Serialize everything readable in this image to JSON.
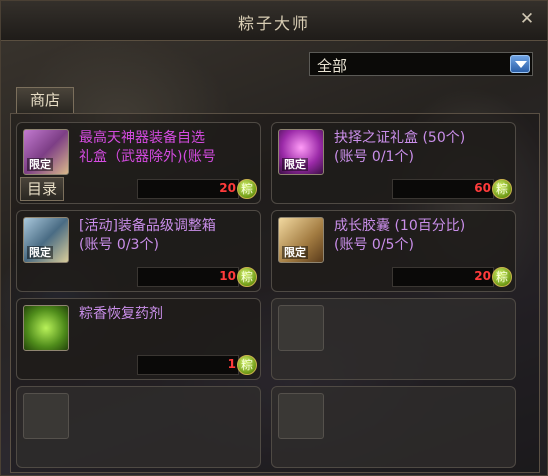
{
  "window": {
    "title": "粽子大师",
    "close_label": "✕"
  },
  "filter": {
    "selected": "全部"
  },
  "tab": {
    "label": "商店"
  },
  "menu_tag": {
    "label": "目录"
  },
  "items": [
    {
      "name": "最高天神器装备自选\n礼盒（武器除外)(账号",
      "badge": "限定",
      "price": "20",
      "color": "purple",
      "icon": "purple-chest-icon"
    },
    {
      "name": "抉择之证礼盒 (50个)\n(账号 0/1个)",
      "badge": "限定",
      "price": "60",
      "color": "lavender",
      "icon": "magic-chest-icon"
    },
    {
      "name": "[活动]装备品级调整箱\n(账号 0/3个)",
      "badge": "限定",
      "price": "10",
      "color": "lavender",
      "icon": "blue-chest-icon"
    },
    {
      "name": "成长胶囊 (10百分比)\n(账号 0/5个)",
      "badge": "限定",
      "price": "20",
      "color": "lavender",
      "icon": "scroll-icon"
    },
    {
      "name": "粽香恢复药剂",
      "badge": "",
      "price": "1",
      "color": "lavender",
      "icon": "potion-icon"
    }
  ],
  "coin_symbol": "粽"
}
